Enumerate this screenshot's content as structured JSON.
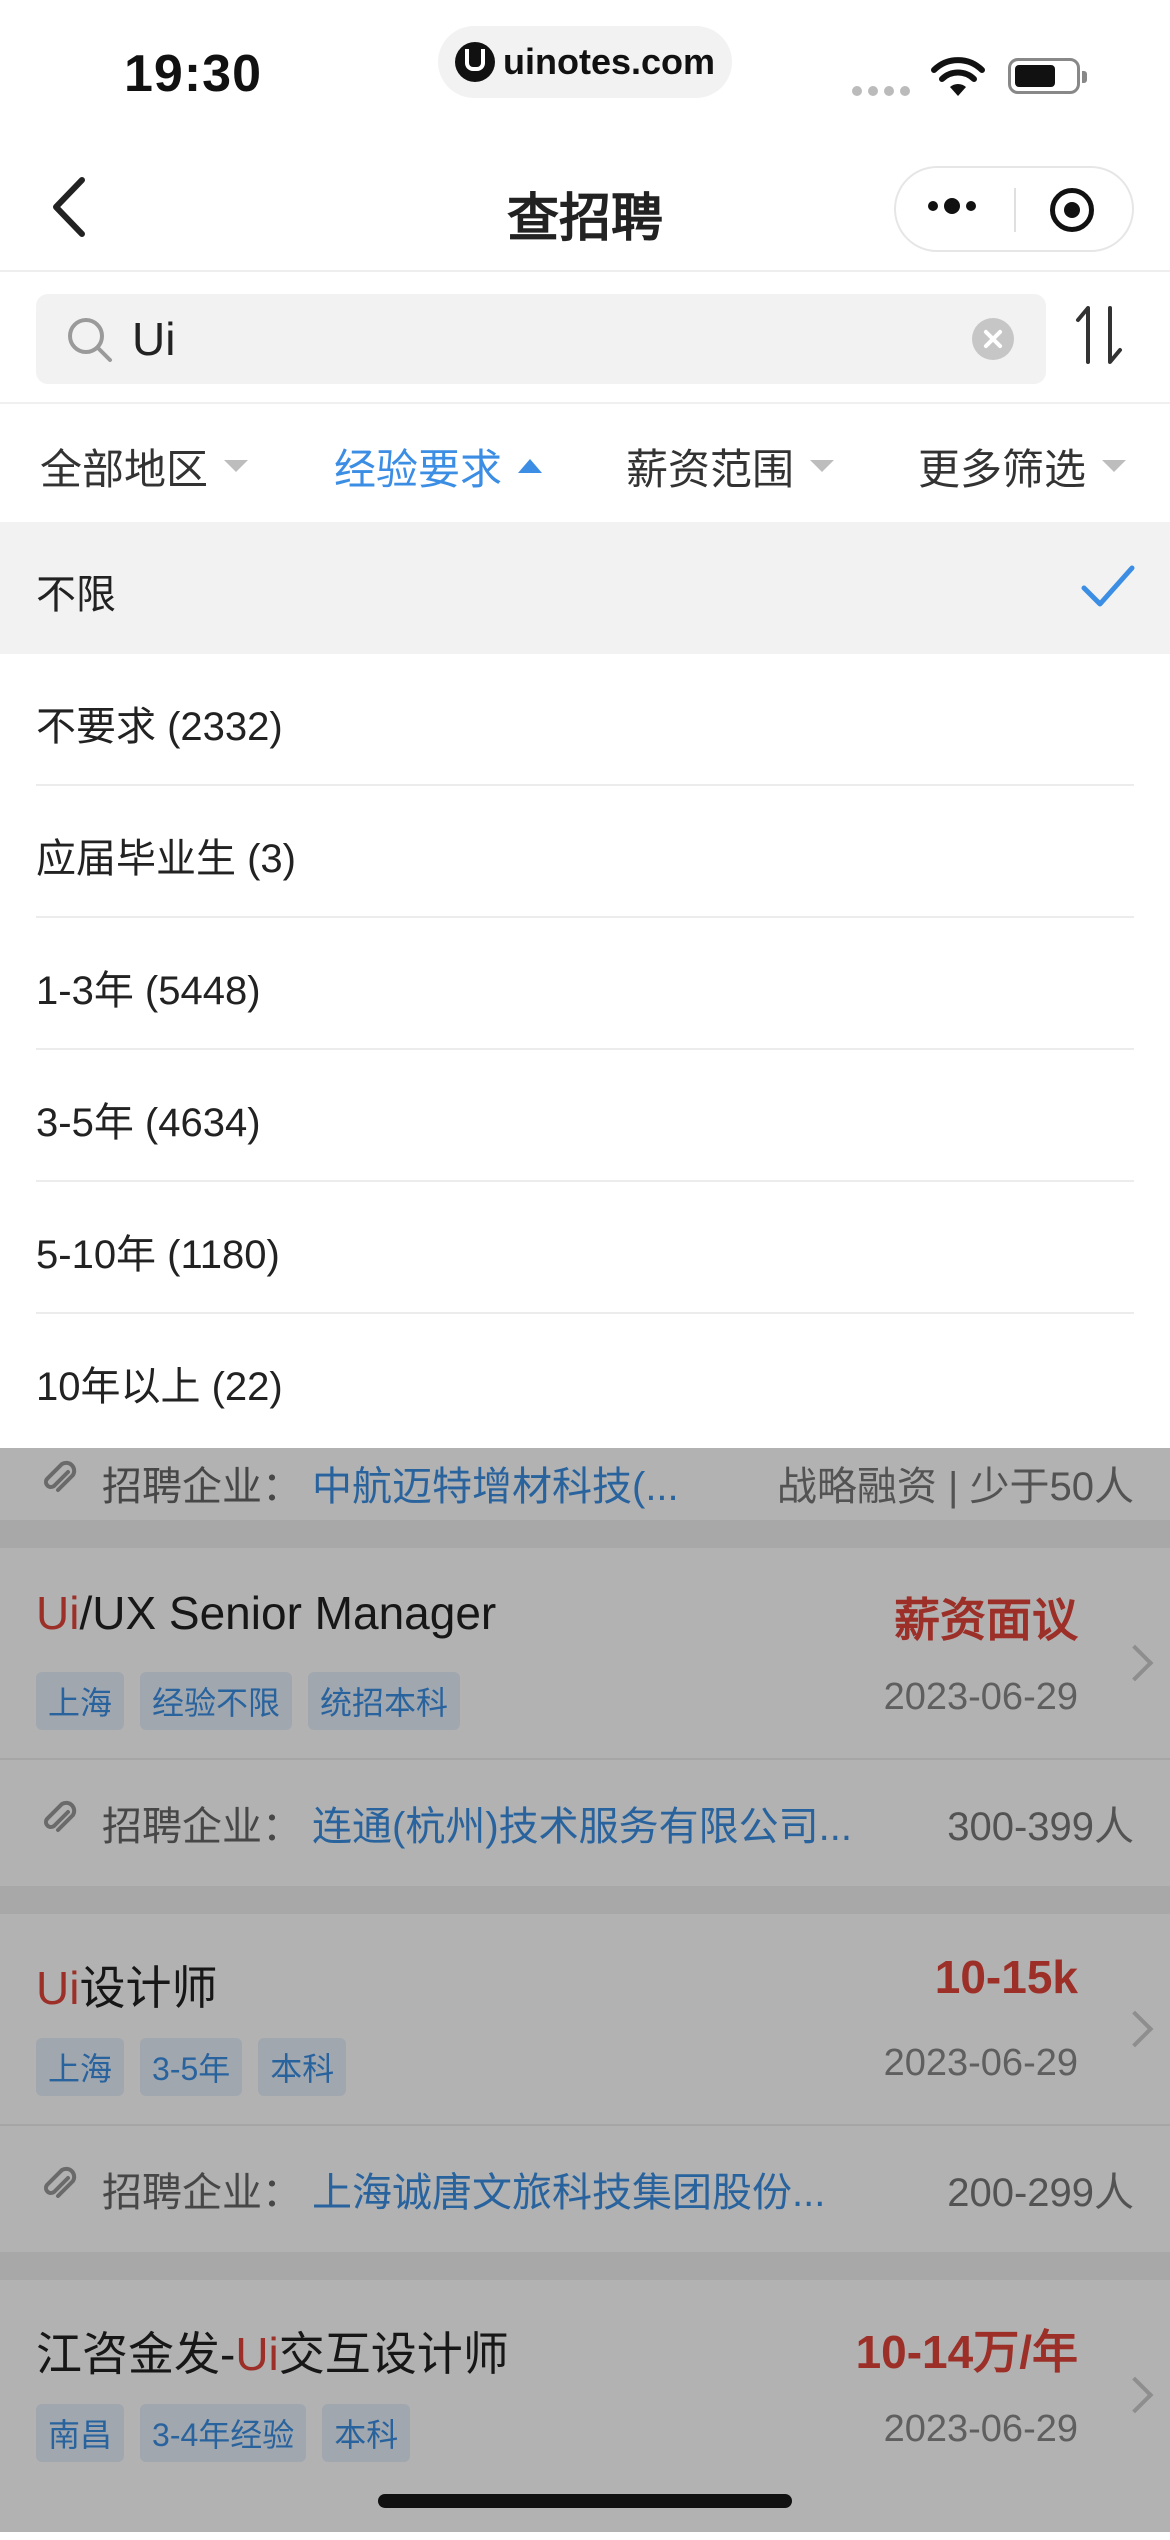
{
  "status_bar": {
    "time": "19:30",
    "url": "uinotes.com"
  },
  "nav": {
    "title": "查招聘"
  },
  "search": {
    "query": "Ui"
  },
  "filters": [
    {
      "label": "全部地区",
      "active": false
    },
    {
      "label": "经验要求",
      "active": true
    },
    {
      "label": "薪资范围",
      "active": false
    },
    {
      "label": "更多筛选",
      "active": false
    }
  ],
  "dropdown": {
    "options": [
      "不限",
      "不要求 (2332)",
      "应届毕业生 (3)",
      "1-3年 (5448)",
      "3-5年 (4634)",
      "5-10年 (1180)",
      "10年以上 (22)"
    ],
    "selected_index": 0
  },
  "colors": {
    "accent": "#3b8ee3",
    "salary": "#e0453b"
  },
  "jobs": {
    "partial_company": {
      "label": "招聘企业：",
      "name": "中航迈特增材科技(...",
      "size": "战略融资 | 少于50人"
    },
    "items": [
      {
        "title_hl": "Ui",
        "title_rest": "/UX Senior Manager",
        "salary": "薪资面议",
        "tags": [
          "上海",
          "经验不限",
          "统招本科"
        ],
        "date": "2023-06-29",
        "company_label": "招聘企业：",
        "company": "连通(杭州)技术服务有限公司...",
        "size": "300-399人"
      },
      {
        "title_hl": "Ui",
        "title_rest": "设计师",
        "salary": "10-15k",
        "tags": [
          "上海",
          "3-5年",
          "本科"
        ],
        "date": "2023-06-29",
        "company_label": "招聘企业：",
        "company": "上海诚唐文旅科技集团股份...",
        "size": "200-299人"
      },
      {
        "title_pre": "江咨金发-",
        "title_hl": "Ui",
        "title_rest": "交互设计师",
        "salary": "10-14万/年",
        "tags": [
          "南昌",
          "3-4年经验",
          "本科"
        ],
        "date": "2023-06-29"
      }
    ]
  }
}
